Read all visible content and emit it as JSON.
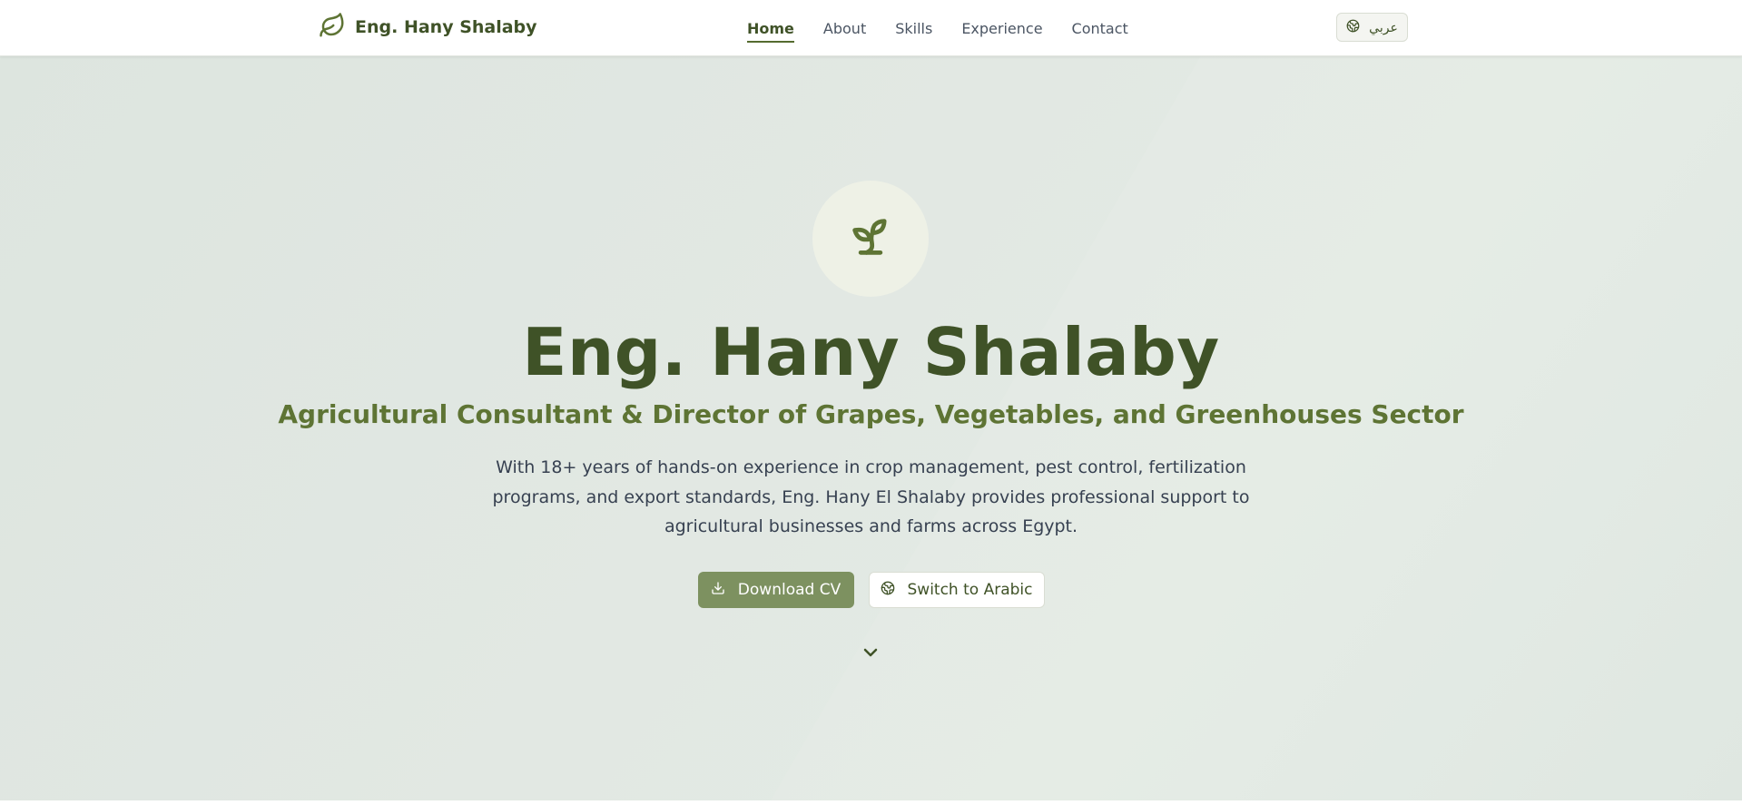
{
  "navbar": {
    "brand_name": "Eng. Hany Shalaby",
    "brand_icon": "leaf-icon",
    "links": [
      {
        "label": "Home",
        "active": true
      },
      {
        "label": "About",
        "active": false
      },
      {
        "label": "Skills",
        "active": false
      },
      {
        "label": "Experience",
        "active": false
      },
      {
        "label": "Contact",
        "active": false
      }
    ],
    "language_button": {
      "label": "عربي",
      "icon": "globe-icon"
    }
  },
  "hero": {
    "icon": "sprout-icon",
    "title": "Eng. Hany Shalaby",
    "subtitle": "Agricultural Consultant & Director of Grapes, Vegetables, and Greenhouses Sector",
    "description": "With 18+ years of hands-on experience in crop management, pest control, fertilization programs, and export standards, Eng. Hany El Shalaby provides professional support to agricultural businesses and farms across Egypt.",
    "primary_button": {
      "label": "Download CV",
      "icon": "download-icon"
    },
    "secondary_button": {
      "label": "Switch to Arabic",
      "icon": "globe-icon"
    },
    "scroll_icon": "chevron-down-icon"
  },
  "colors": {
    "primary": "#3f5227",
    "accent": "#5e7434",
    "button_fill": "#7d9160",
    "hero_background": "#e0e7e1"
  }
}
